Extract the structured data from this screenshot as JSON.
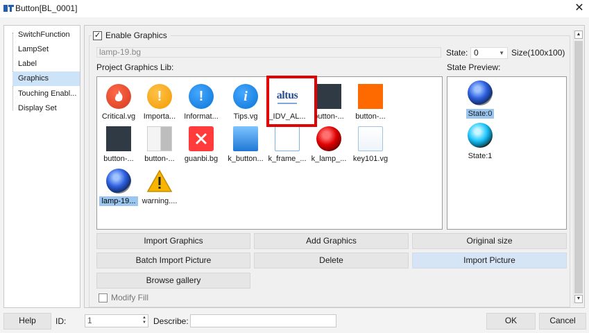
{
  "window": {
    "title": "Button[BL_0001]",
    "close_glyph": "✕"
  },
  "nav": {
    "items": [
      {
        "label": "SwitchFunction"
      },
      {
        "label": "LampSet"
      },
      {
        "label": "Label"
      },
      {
        "label": "Graphics"
      },
      {
        "label": "Touching Enabl..."
      },
      {
        "label": "Display Set"
      }
    ],
    "selected": "Graphics"
  },
  "graphics": {
    "enable_label": "Enable Graphics",
    "enable_checked": true,
    "file_name": "lamp-19.bg",
    "state_label": "State:",
    "state_value": "0",
    "size_label": "Size(100x100)",
    "lib_label": "Project Graphics Lib:",
    "preview_label": "State Preview:",
    "modify_fill_label": "Modify Fill",
    "modify_fill_checked": false,
    "library": [
      {
        "label": "Critical.vg",
        "icon": "critical-icon"
      },
      {
        "label": "Importa...",
        "icon": "important-icon"
      },
      {
        "label": "Informat...",
        "icon": "information-icon"
      },
      {
        "label": "Tips.vg",
        "icon": "tips-icon"
      },
      {
        "label": "_IDV_AL...",
        "icon": "altus-logo-icon",
        "logo_text": "altus"
      },
      {
        "label": "button-...",
        "icon": "dark-button-icon"
      },
      {
        "label": "button-...",
        "icon": "orange-button-icon"
      },
      {
        "label": "button-...",
        "icon": "dark-button-icon"
      },
      {
        "label": "button-...",
        "icon": "half-white-button-icon"
      },
      {
        "label": "guanbi.bg",
        "icon": "close-button-icon"
      },
      {
        "label": "k_button...",
        "icon": "blue-button-icon"
      },
      {
        "label": "k_frame_...",
        "icon": "frame-icon"
      },
      {
        "label": "k_lamp_...",
        "icon": "red-lamp-icon"
      },
      {
        "label": "key101.vg",
        "icon": "key-icon"
      },
      {
        "label": "lamp-19...",
        "icon": "blue-lamp-icon",
        "selected": true
      },
      {
        "label": "warning....",
        "icon": "warning-icon"
      }
    ],
    "preview": [
      {
        "label": "State:0",
        "icon": "dark-blue-lamp-icon",
        "selected": true
      },
      {
        "label": "State:1",
        "icon": "cyan-lamp-icon"
      }
    ],
    "buttons": {
      "import_graphics": "Import Graphics",
      "add_graphics": "Add Graphics",
      "original_size": "Original size",
      "batch_import": "Batch Import Picture",
      "delete": "Delete",
      "import_picture": "Import Picture",
      "browse_gallery": "Browse gallery"
    }
  },
  "footer": {
    "help": "Help",
    "id_label": "ID:",
    "id_value": "1",
    "describe_label": "Describe:",
    "describe_value": "",
    "ok": "OK",
    "cancel": "Cancel"
  },
  "colors": {
    "highlight_border": "#e30000",
    "selection": "#9ac6ef",
    "nav_selection": "#cde3f7"
  }
}
